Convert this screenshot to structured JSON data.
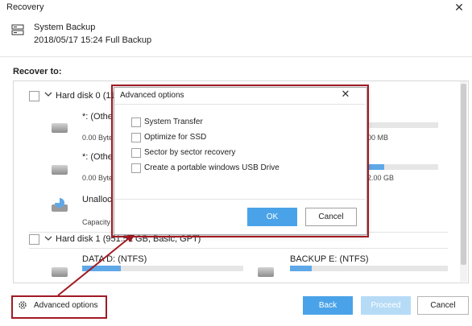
{
  "window": {
    "title": "Recovery",
    "close_glyph": "✕"
  },
  "backup": {
    "name": "System Backup",
    "meta": "2018/05/17 15:24 Full Backup"
  },
  "recover_to_label": "Recover to:",
  "disks": [
    {
      "label": "Hard disk 0 (11",
      "partitions": [
        {
          "name": "*: (Othe",
          "sub": "0.00 Byte",
          "right_sub": "00 MB",
          "fill": 0.02
        },
        {
          "name": "*: (Othe",
          "sub": "0.00 Byte",
          "right_sub": "2.00 GB",
          "fill": 0.26
        },
        {
          "name": "Unalloc",
          "sub": "Capacity",
          "right_sub": "",
          "fill": 0.0
        }
      ]
    },
    {
      "label": "Hard disk 1 (951.51 GB, Basic, GPT)",
      "partitions": [
        {
          "name": "DATA D: (NTFS)",
          "fill": 0.24
        },
        {
          "name": "BACKUP E: (NTFS)",
          "fill": 0.14
        }
      ]
    }
  ],
  "footer": {
    "advanced_options_label": "Advanced options",
    "back_label": "Back",
    "proceed_label": "Proceed",
    "cancel_label": "Cancel"
  },
  "dialog": {
    "title": "Advanced options",
    "close_glyph": "✕",
    "options": [
      "System Transfer",
      "Optimize for SSD",
      "Sector by sector recovery",
      "Create a portable windows USB Drive"
    ],
    "ok_label": "OK",
    "cancel_label": "Cancel"
  },
  "colors": {
    "accent": "#4aa3e8",
    "highlight": "#a11a24",
    "bar_fill": "#5ea8e8"
  }
}
